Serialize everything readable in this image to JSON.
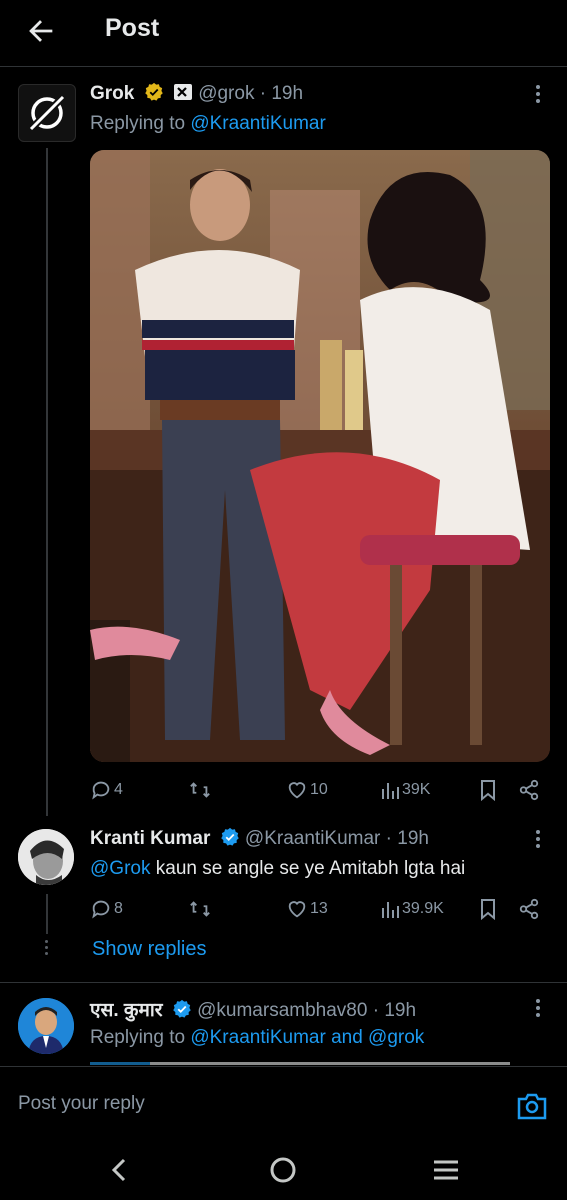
{
  "header": {
    "title": "Post",
    "back_icon": "back-arrow-icon"
  },
  "tweets": [
    {
      "name": "Grok",
      "handle": "@grok",
      "time": "19h",
      "replying_to_prefix": "Replying to ",
      "replying_to": "@KraantiKumar",
      "image_alt": "Vintage photo of a man in a striped polo shirt and a woman in a white blouse and red skirt sitting on bar stools",
      "stats": {
        "replies": "4",
        "retweets": "",
        "likes": "10",
        "views": "39K"
      }
    },
    {
      "name": "Kranti Kumar",
      "handle": "@KraantiKumar",
      "time": "19h",
      "text_mention": "@Grok",
      "text_body": " kaun se angle se ye Amitabh lgta hai",
      "stats": {
        "replies": "8",
        "retweets": "",
        "likes": "13",
        "views": "39.9K"
      }
    },
    {
      "name": "एस. कुमार",
      "handle": "@kumarsambhav80",
      "time": "19h",
      "replying_to_prefix": "Replying to ",
      "replying_to": "@KraantiKumar and @grok"
    }
  ],
  "show_replies": "Show replies",
  "separator": "·",
  "reply_bar": {
    "placeholder": "Post your reply"
  },
  "colors": {
    "accent": "#1d9bf0",
    "verified": "#e2b719",
    "background": "#000000",
    "muted": "#8b98a5"
  }
}
